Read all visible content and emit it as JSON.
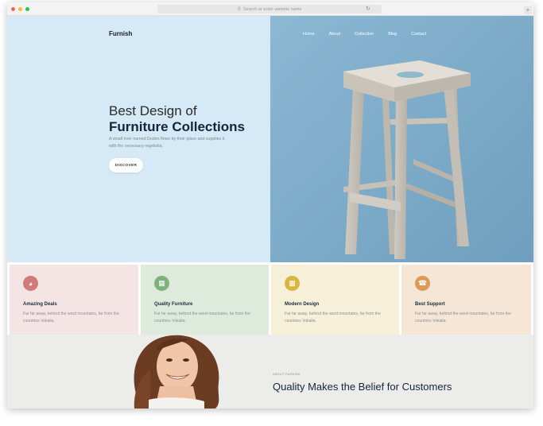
{
  "browser": {
    "url_placeholder": "Search or enter website name",
    "reload_icon": "reload-icon",
    "new_tab_label": "+"
  },
  "site": {
    "logo": "Furnish",
    "nav": [
      {
        "label": "Home",
        "active": true
      },
      {
        "label": "About"
      },
      {
        "label": "Collection"
      },
      {
        "label": "Blog"
      },
      {
        "label": "Contact"
      }
    ]
  },
  "hero": {
    "title_line1": "Best Design of",
    "title_line2": "Furniture Collections",
    "text": "A small river named Duden flows by their place and supplies it with the necessary regelialia.",
    "button": "DISCOVER",
    "bg_left": "#d6e9f6",
    "bg_right": "#7fafcc"
  },
  "features": [
    {
      "title": "Amazing Deals",
      "desc": "Far far away, behind the word mountains, far from the countries Vokalia.",
      "icon": "bowl-icon",
      "icon_color": "#d07a7a",
      "bg": "#f5e4e4"
    },
    {
      "title": "Quality Furniture",
      "desc": "Far far away, behind the word mountains, far from the countries Vokalia.",
      "icon": "furniture-icon",
      "icon_color": "#7fb27a",
      "bg": "#deebdc"
    },
    {
      "title": "Modern Design",
      "desc": "Far far away, behind the word mountains, far from the countries Vokalia.",
      "icon": "sofa-icon",
      "icon_color": "#d8b63f",
      "bg": "#f6f0d8"
    },
    {
      "title": "Best Support",
      "desc": "Far far away, behind the word mountains, far from the countries Vokalia.",
      "icon": "support-icon",
      "icon_color": "#dd9a57",
      "bg": "#f6e6d5"
    }
  ],
  "about": {
    "subtitle": "ABOUT FURNISH",
    "title": "Quality Makes the Belief for Customers"
  }
}
